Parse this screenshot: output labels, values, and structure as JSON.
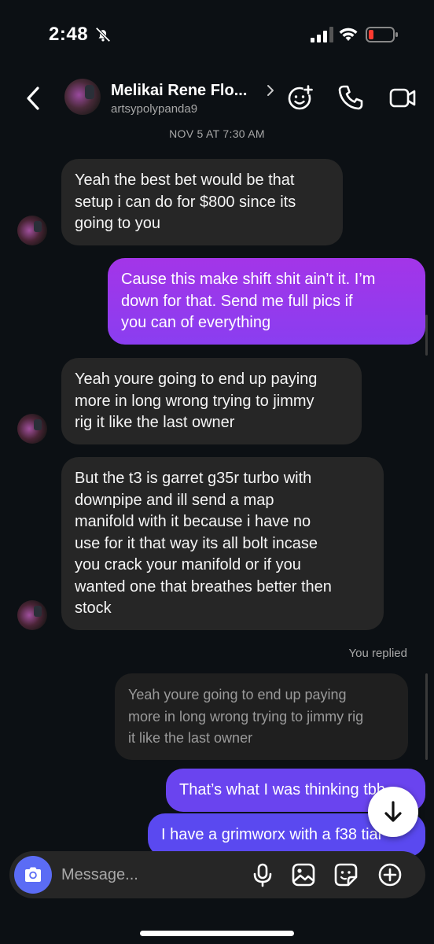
{
  "status_bar": {
    "time": "2:48"
  },
  "header": {
    "name": "Melikai Rene Flo...",
    "handle": "artsypolypanda9"
  },
  "date_stamp": "NOV 5 AT 7:30 AM",
  "messages": [
    {
      "sender": "them",
      "lines": [
        "Yeah the best bet would be that",
        "setup i can do for $800 since its",
        "going to you"
      ]
    },
    {
      "sender": "me",
      "lines": [
        "Cause this make shift shit ain’t it. I’m",
        "down for that. Send me full pics if",
        "you can of everything"
      ]
    },
    {
      "sender": "them",
      "lines": [
        "Yeah youre going to end up paying",
        "more in long wrong trying to jimmy",
        "rig it like the last owner"
      ]
    },
    {
      "sender": "them",
      "lines": [
        "But the t3 is garret g35r turbo with",
        "downpipe and ill send a map",
        "manifold with it because i have no",
        "use for it that way its all bolt incase",
        "you crack your manifold or if you",
        "wanted one that breathes better then",
        "stock"
      ]
    },
    {
      "sender": "reply_quote",
      "lines": [
        "Yeah youre going to end up paying",
        "more in long wrong trying to jimmy rig",
        "it like the last owner"
      ]
    },
    {
      "sender": "me",
      "lines": [
        "That’s what I was thinking tbh"
      ]
    },
    {
      "sender": "me",
      "lines": [
        "I have a grimworx with a f38 tial"
      ]
    }
  ],
  "replied_label": "You replied",
  "composer": {
    "placeholder": "Message..."
  },
  "colors": {
    "background": "#0c1014",
    "incoming_bubble": "#262626",
    "outgoing_gradient_top": "#a335e8",
    "outgoing_bottom": "#5a49f0",
    "camera_button": "#5b6cf5"
  },
  "icons": [
    "bell-off-icon",
    "signal-icon",
    "wifi-icon",
    "battery-low-icon",
    "back-chevron-icon",
    "sticker-add-icon",
    "phone-icon",
    "video-icon",
    "arrow-down-icon",
    "camera-icon",
    "microphone-icon",
    "gallery-icon",
    "sticker-icon",
    "plus-circle-icon"
  ]
}
